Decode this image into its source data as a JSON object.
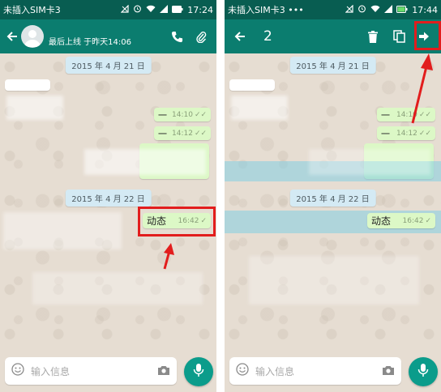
{
  "left": {
    "status": {
      "carrier": "未插入SIM卡3",
      "time": "17:24"
    },
    "header": {
      "last_seen": "最后上线 于昨天14:06"
    },
    "dates": [
      "2015 年 4 月 21 日",
      "2015 年 4 月 22 日"
    ],
    "out_messages": [
      {
        "text": "一",
        "time": "14:10"
      },
      {
        "text": "一",
        "time": "14:12"
      },
      {
        "text": "动态",
        "time": "16:42"
      }
    ],
    "input_placeholder": "输入信息"
  },
  "right": {
    "status": {
      "carrier": "未插入SIM卡3 •••",
      "time": "17:44"
    },
    "header": {
      "selected_count": "2"
    },
    "dates": [
      "2015 年 4 月 21 日",
      "2015 年 4 月 22 日"
    ],
    "out_messages": [
      {
        "text": "一",
        "time": "14:10"
      },
      {
        "text": "一",
        "time": "14:12"
      },
      {
        "text": "动态",
        "time": "16:42"
      }
    ],
    "input_placeholder": "输入信息"
  },
  "colors": {
    "header": "#0b7d6f",
    "status_bar": "#085d51",
    "outgoing_bubble": "#dcf8c6",
    "highlight": "#e21d1d",
    "selection": "#82cde1"
  },
  "icons": [
    "back-arrow-icon",
    "phone-icon",
    "paperclip-icon",
    "trash-icon",
    "copy-icon",
    "forward-arrow-icon",
    "emoji-icon",
    "camera-icon",
    "mic-icon",
    "wifi-icon",
    "alarm-icon",
    "signal-icon",
    "battery-icon"
  ]
}
